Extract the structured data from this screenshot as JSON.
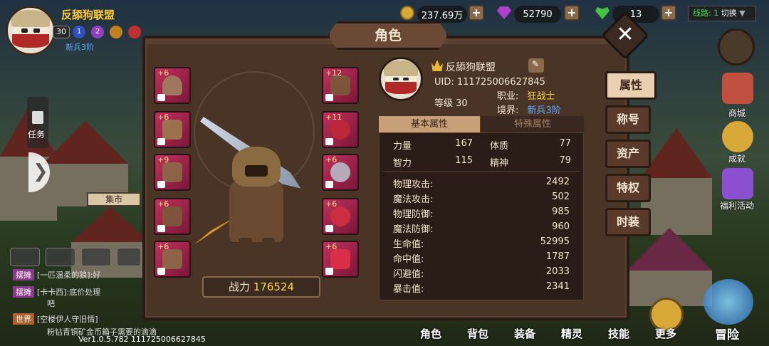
{
  "player": {
    "name": "反舔狗联盟",
    "level": "30",
    "rank": "新兵3阶",
    "badges": [
      "1",
      "2"
    ]
  },
  "resources": {
    "gold": "237.69万",
    "gems": "52790",
    "stamina": "13"
  },
  "line_selector": {
    "label": "线路: 1",
    "action": "切换"
  },
  "panel": {
    "title": "角色"
  },
  "equipment": {
    "left": [
      {
        "plus": "+6",
        "icon": "helmet"
      },
      {
        "plus": "+6",
        "icon": "shoulder"
      },
      {
        "plus": "+9",
        "icon": "armor"
      },
      {
        "plus": "+6",
        "icon": "gloves"
      },
      {
        "plus": "+6",
        "icon": "boots"
      }
    ],
    "right": [
      {
        "plus": "+12",
        "icon": "crossbow"
      },
      {
        "plus": "+11",
        "icon": "ring-red"
      },
      {
        "plus": "+6",
        "icon": "ring-silver"
      },
      {
        "plus": "+6",
        "icon": "necklace"
      },
      {
        "plus": "+6",
        "icon": "gem-red"
      }
    ]
  },
  "hero": {
    "power_label": "战力",
    "power_value": "176524"
  },
  "profile": {
    "name": "反舔狗联盟",
    "uid_label": "UID:",
    "uid": "111725006627845",
    "level_label": "等级",
    "level": "30",
    "class_label": "职业:",
    "class": "狂战士",
    "realm_label": "境界:",
    "realm": "新兵3阶"
  },
  "tabs": {
    "basic": "基本属性",
    "special": "特殊属性"
  },
  "base_stats": [
    {
      "label": "力量",
      "value": "167"
    },
    {
      "label": "体质",
      "value": "77"
    },
    {
      "label": "智力",
      "value": "115"
    },
    {
      "label": "精神",
      "value": "79"
    }
  ],
  "stats": [
    {
      "label": "物理攻击:",
      "value": "2492"
    },
    {
      "label": "魔法攻击:",
      "value": "502"
    },
    {
      "label": "物理防御:",
      "value": "985"
    },
    {
      "label": "魔法防御:",
      "value": "960"
    },
    {
      "label": "生命值:",
      "value": "52995"
    },
    {
      "label": "命中值:",
      "value": "1787"
    },
    {
      "label": "闪避值:",
      "value": "2033"
    },
    {
      "label": "暴击值:",
      "value": "2341"
    }
  ],
  "side_tabs": [
    "属性",
    "称号",
    "资产",
    "特权",
    "时装"
  ],
  "right_menu": [
    "商城",
    "成就",
    "福利活动"
  ],
  "left_ui": {
    "task": "任务",
    "market": "集市"
  },
  "chat": [
    {
      "tag": "摆摊",
      "text": "[一匹温柔的狼]:好"
    },
    {
      "tag": "摆摊",
      "text": "[卡卡西]:底价处理"
    },
    {
      "tag": "",
      "text": "吧"
    },
    {
      "tag": "世界",
      "text": "[空楼伊人守旧情]"
    },
    {
      "tag": "",
      "text": "粉钻青铜矿金币箱子需要的滴滴"
    }
  ],
  "bottom_nav": [
    "角色",
    "背包",
    "装备",
    "精灵",
    "技能",
    "更多",
    "冒险"
  ],
  "version": "Ver1.0.5.782 111725006627845"
}
